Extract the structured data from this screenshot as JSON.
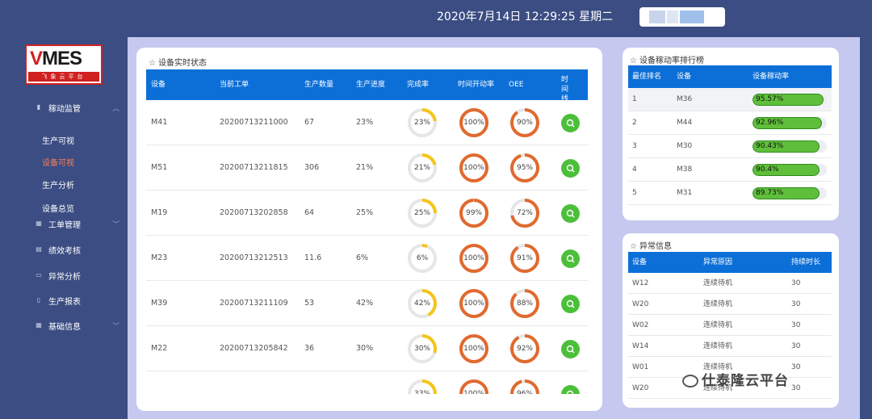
{
  "header": {
    "datetime": "2020年7月14日 12:29:25 星期二"
  },
  "logo": {
    "text_main": "VMES",
    "text_sub": "飞象云平台"
  },
  "sidebar": {
    "menus": [
      {
        "label": "稼动监管",
        "icon": "bar-chart-icon",
        "chevron": "up"
      },
      {
        "label": "工单管理",
        "icon": "grid-icon",
        "chevron": "down"
      },
      {
        "label": "绩效考核",
        "icon": "calendar-icon",
        "chevron": ""
      },
      {
        "label": "异常分析",
        "icon": "monitor-icon",
        "chevron": ""
      },
      {
        "label": "生产报表",
        "icon": "document-icon",
        "chevron": ""
      },
      {
        "label": "基础信息",
        "icon": "grid-icon",
        "chevron": "down"
      }
    ],
    "sub_items": [
      {
        "label": "生产可视",
        "active": false
      },
      {
        "label": "设备可视",
        "active": true
      },
      {
        "label": "生产分析",
        "active": false
      },
      {
        "label": "设备总览",
        "active": false
      }
    ]
  },
  "status_panel": {
    "title": "设备实时状态",
    "headers": [
      "设备",
      "当前工单",
      "生产数量",
      "生产进度",
      "完成率",
      "时间开动率",
      "OEE",
      "时间线"
    ],
    "rows": [
      {
        "device": "M41",
        "order": "20200713211000",
        "qty": "67",
        "progress": "23%",
        "completion": 23,
        "uptime": 100,
        "oee": 90
      },
      {
        "device": "M51",
        "order": "20200713211815",
        "qty": "306",
        "progress": "21%",
        "completion": 21,
        "uptime": 100,
        "oee": 95
      },
      {
        "device": "M19",
        "order": "20200713202858",
        "qty": "64",
        "progress": "25%",
        "completion": 25,
        "uptime": 99,
        "oee": 72
      },
      {
        "device": "M23",
        "order": "20200713212513",
        "qty": "11.6",
        "progress": "6%",
        "completion": 6,
        "uptime": 100,
        "oee": 91
      },
      {
        "device": "M39",
        "order": "20200713211109",
        "qty": "53",
        "progress": "42%",
        "completion": 42,
        "uptime": 100,
        "oee": 88
      },
      {
        "device": "M22",
        "order": "20200713205842",
        "qty": "36",
        "progress": "30%",
        "completion": 30,
        "uptime": 100,
        "oee": 92
      },
      {
        "device": "",
        "order": "",
        "qty": "",
        "progress": "",
        "completion": 33,
        "uptime": 100,
        "oee": 96
      }
    ]
  },
  "ranking_panel": {
    "title": "设备稼动率排行榜",
    "headers": [
      "最佳排名",
      "设备",
      "设备稼动率"
    ],
    "rows": [
      {
        "rank": "1",
        "device": "M36",
        "rate_label": "95.57%",
        "rate": 95.57
      },
      {
        "rank": "2",
        "device": "M44",
        "rate_label": "92.96%",
        "rate": 92.96
      },
      {
        "rank": "3",
        "device": "M30",
        "rate_label": "90.43%",
        "rate": 90.43
      },
      {
        "rank": "4",
        "device": "M38",
        "rate_label": "90.4%",
        "rate": 90.4
      },
      {
        "rank": "5",
        "device": "M31",
        "rate_label": "89.73%",
        "rate": 89.73
      }
    ]
  },
  "abnormal_panel": {
    "title": "异常信息",
    "headers": [
      "设备",
      "异常原因",
      "持续时长"
    ],
    "rows": [
      {
        "device": "W12",
        "reason": "连续待机",
        "duration": "30"
      },
      {
        "device": "W20",
        "reason": "连续待机",
        "duration": "30"
      },
      {
        "device": "W02",
        "reason": "连续待机",
        "duration": "30"
      },
      {
        "device": "W14",
        "reason": "连续待机",
        "duration": "30"
      },
      {
        "device": "W01",
        "reason": "连续待机",
        "duration": "30"
      },
      {
        "device": "W20",
        "reason": "连续待机",
        "duration": "30"
      }
    ]
  },
  "watermark": {
    "text": "仕泰隆云平台"
  },
  "colors": {
    "header_blue": "#0c6fd8",
    "completion": "#f5c518",
    "uptime": "#e06a2f",
    "bar_green": "#5fbf3a",
    "timeline_green": "#4cbf3a",
    "active_menu": "#ff7d5a"
  }
}
